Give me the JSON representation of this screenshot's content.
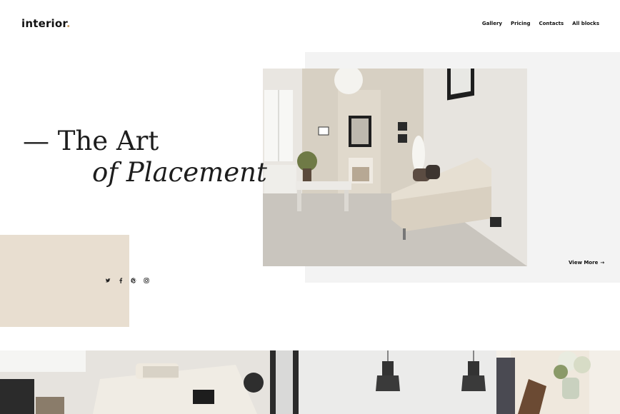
{
  "brand": {
    "name": "interior",
    "dot": "."
  },
  "nav": {
    "items": [
      "Gallery",
      "Pricing",
      "Contacts",
      "All blocks"
    ]
  },
  "hero": {
    "title_line1": "— The Art",
    "title_line2": "of Placement",
    "view_more": "View More",
    "arrow": "→"
  },
  "socials": [
    "twitter-icon",
    "facebook-icon",
    "pinterest-icon",
    "instagram-icon"
  ],
  "colors": {
    "accent_dot": "#c9a06a",
    "beige": "#e8ded0",
    "panel_gray": "#f3f3f3"
  }
}
